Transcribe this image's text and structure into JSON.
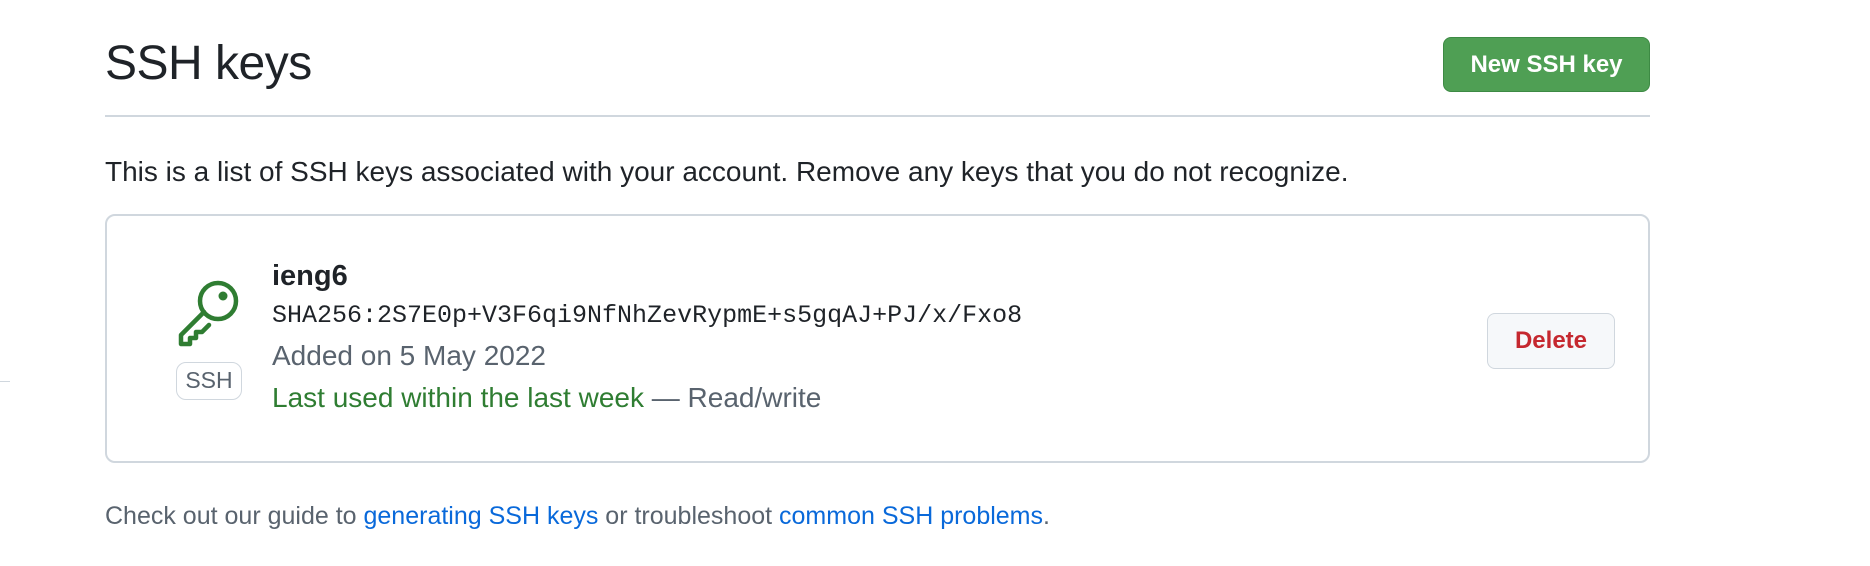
{
  "header": {
    "title": "SSH keys",
    "new_key_label": "New SSH key"
  },
  "intro_text": "This is a list of SSH keys associated with your account. Remove any keys that you do not recognize.",
  "keys": [
    {
      "title": "ieng6",
      "fingerprint": "SHA256:2S7E0p+V3F6qi9NfNhZevRypmE+s5gqAJ+PJ/x/Fxo8",
      "added": "Added on 5 May 2022",
      "last_used": "Last used within the last week",
      "access": " — Read/write",
      "badge": "SSH",
      "icon": "key-icon",
      "delete_label": "Delete"
    }
  ],
  "footer": {
    "prefix": "Check out our guide to ",
    "link1": "generating SSH keys",
    "middle": " or troubleshoot ",
    "link2": "common SSH problems",
    "suffix": "."
  },
  "colors": {
    "primary_button": "#4f9f54",
    "danger_text": "#c5282f",
    "last_used_text": "#2f7d32",
    "link": "#0969da",
    "key_icon": "#2f7d32"
  }
}
